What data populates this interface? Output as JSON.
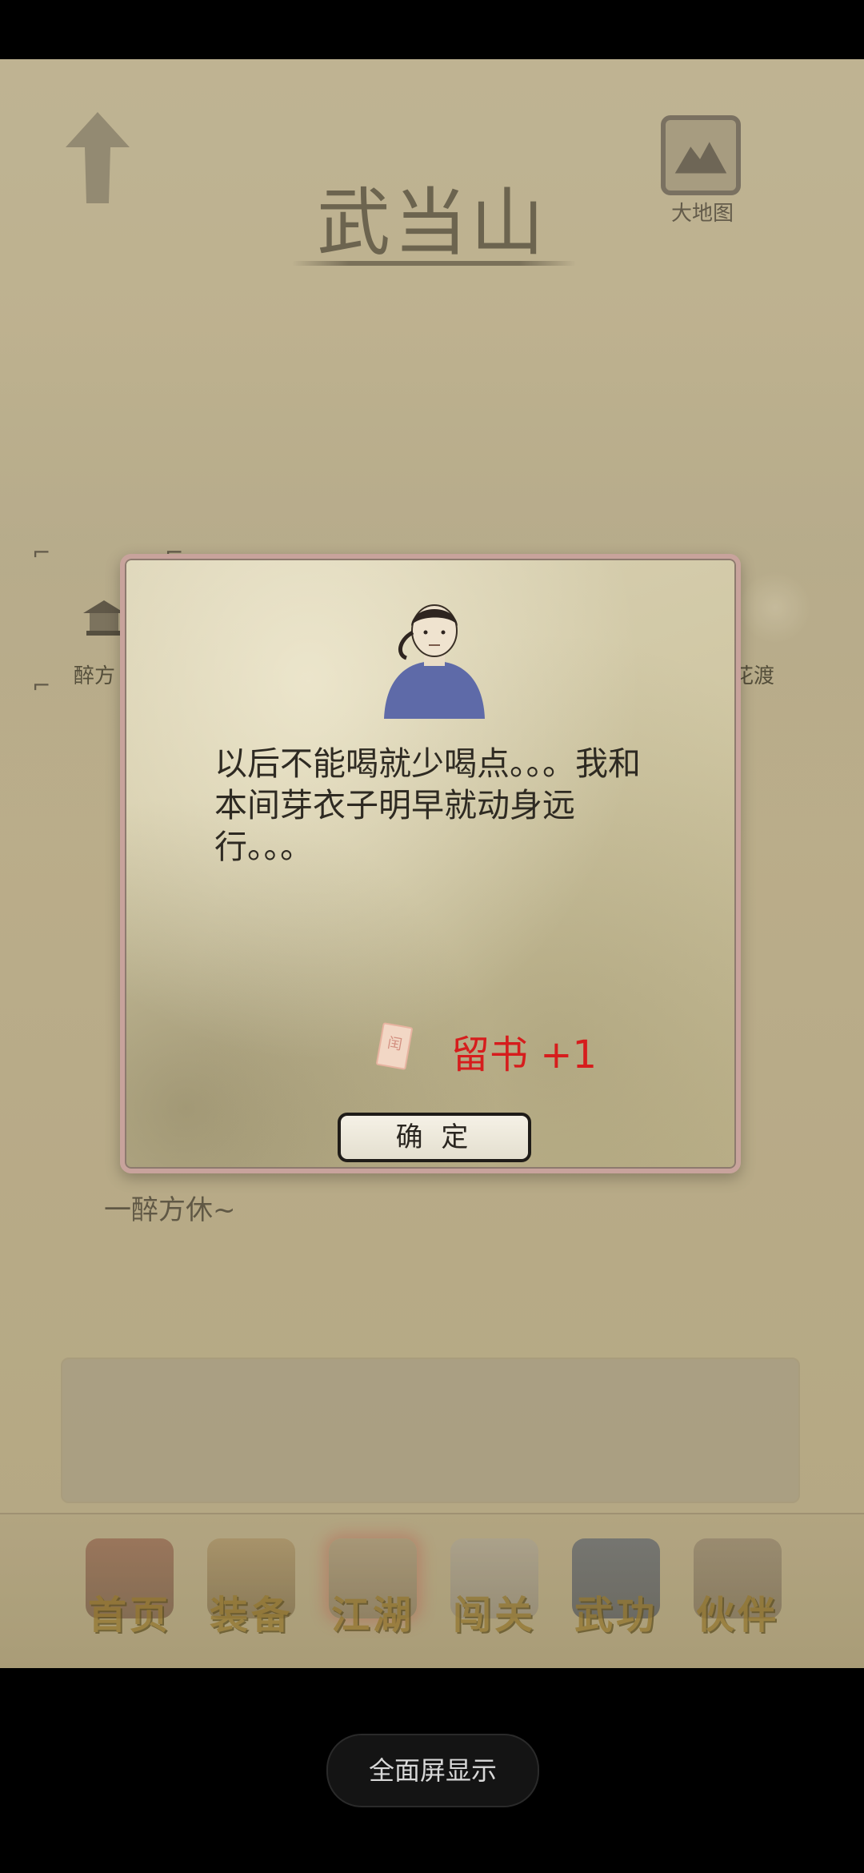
{
  "header": {
    "title": "武当山",
    "map_label": "大地图"
  },
  "locations": {
    "left_label": "醉方",
    "right_label": "花渡"
  },
  "description": "一醉方休~",
  "dialog": {
    "message": "以后不能喝就少喝点。。。我和本间芽衣子明早就动身远行。。。",
    "reward": "留书 +1",
    "reward_icon_glyph": "闰",
    "confirm_label": "确 定"
  },
  "nav": {
    "items": [
      {
        "label": "首页"
      },
      {
        "label": "装备"
      },
      {
        "label": "江湖",
        "active": true
      },
      {
        "label": "闯关"
      },
      {
        "label": "武功"
      },
      {
        "label": "伙伴"
      }
    ]
  },
  "system": {
    "fullscreen_label": "全面屏显示"
  },
  "colors": {
    "reward": "#d61d1d",
    "nav_text": "#9a7a2a",
    "dialog_border": "#c8a39c"
  }
}
